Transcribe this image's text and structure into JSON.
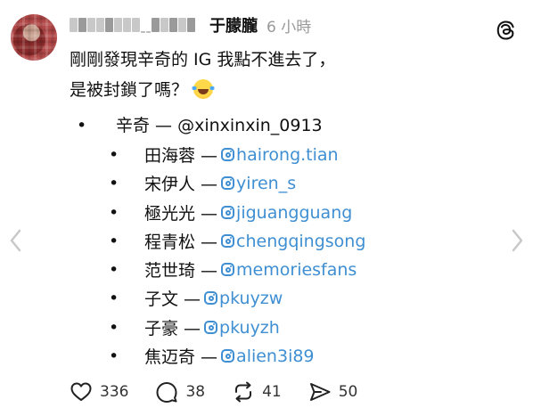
{
  "post": {
    "author_name": "于朦朧",
    "timestamp": "6 小時",
    "text_line1": "剛剛發現辛奇的 IG 我點不進去了，",
    "text_line2": "是被封鎖了嗎？",
    "main_item": {
      "bullet": "•",
      "text": "辛奇 — @xinxinxin_0913"
    },
    "sub_items": [
      {
        "name": "田海蓉 —",
        "handle": "hairong.tian"
      },
      {
        "name": "宋伊人 —",
        "handle": "yiren_s"
      },
      {
        "name": "極光光 —",
        "handle": "jiguangguang"
      },
      {
        "name": "程青松 —",
        "handle": "chengqingsong"
      },
      {
        "name": "范世琦 —",
        "handle": "memoriesfans"
      },
      {
        "name": "子文 —",
        "handle": "pkuyzw"
      },
      {
        "name": "子豪 —",
        "handle": "pkuyzh"
      },
      {
        "name": "焦迈奇 —",
        "handle": "alien3i89"
      }
    ],
    "bullet": "•"
  },
  "actions": {
    "like_count": "336",
    "comment_count": "38",
    "repost_count": "41",
    "share_count": "50"
  },
  "icons": {
    "like": "heart-icon",
    "comment": "comment-bubble-icon",
    "repost": "repost-icon",
    "share": "send-icon",
    "app": "threads-logo-icon",
    "instagram": "instagram-icon",
    "emoji": "laughing-tears-emoji"
  },
  "colors": {
    "link": "#3f8fd2",
    "timestamp": "#999999",
    "text": "#111111"
  }
}
